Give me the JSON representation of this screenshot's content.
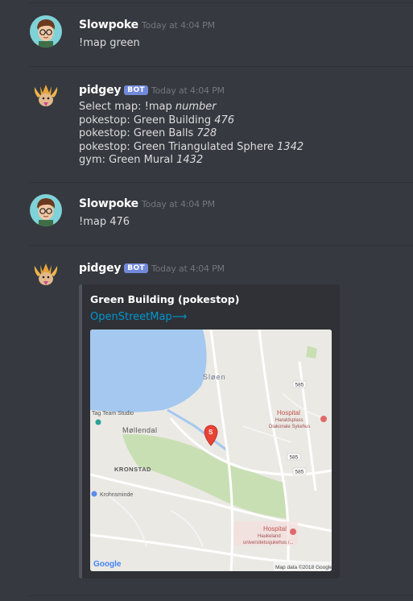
{
  "messages": [
    {
      "author": "Slowpoke",
      "timestamp": "Today at 4:04 PM",
      "text": "!map green"
    },
    {
      "author": "pidgey",
      "badge": "BOT",
      "timestamp": "Today at 4:04 PM",
      "lines": [
        {
          "text": "Select map: !map ",
          "num": "number"
        },
        {
          "text": "pokestop: Green Building ",
          "num": "476"
        },
        {
          "text": "pokestop: Green Balls ",
          "num": "728"
        },
        {
          "text": "pokestop: Green Triangulated Sphere ",
          "num": "1342"
        },
        {
          "text": "gym: Green Mural ",
          "num": "1432"
        }
      ]
    },
    {
      "author": "Slowpoke",
      "timestamp": "Today at 4:04 PM",
      "text": "!map 476"
    },
    {
      "author": "pidgey",
      "badge": "BOT",
      "timestamp": "Today at 4:04 PM",
      "embed": {
        "title": "Green Building (pokestop)",
        "link": "OpenStreetMap⟶",
        "map": {
          "labels": {
            "sloen": "Sløen",
            "tag_team": "Tag Team Studio",
            "mollendal": "Møllendal",
            "kronstad": "KRONSTAD",
            "krohnsminde": "Krohnsminde",
            "hospital1": "Hospital",
            "hospital1_sub1": "Haraldsplass",
            "hospital1_sub2": "Diakonale Sykehus",
            "hospital2": "Hospital",
            "hospital2_sub1": "Haukeland",
            "hospital2_sub2": "universitetssjukehus /...",
            "route1": "585",
            "route2": "585",
            "route3": "585",
            "pin": "S",
            "google": "Google",
            "attribution": "Map data ©2018 Google"
          },
          "colors": {
            "water": "#a4c8f0",
            "park": "#c8dfb4",
            "land": "#ebe9e4",
            "pin": "#e94335"
          }
        }
      }
    }
  ]
}
